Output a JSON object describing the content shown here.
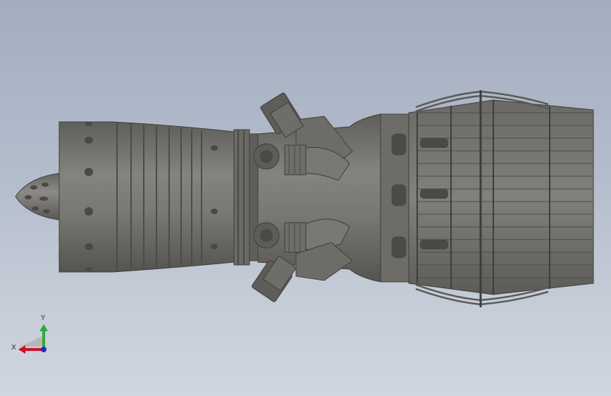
{
  "viewport": {
    "background_top": "#a2adbf",
    "background_bottom": "#d0d6df"
  },
  "model": {
    "body_color": "#767470",
    "dark_color": "#4a4946",
    "light_color": "#8a8884"
  },
  "triad": {
    "x_label": "X",
    "y_label": "Y",
    "x_color": "#c8102e",
    "y_color": "#2eaa3c",
    "z_color": "#1a2fd0"
  }
}
